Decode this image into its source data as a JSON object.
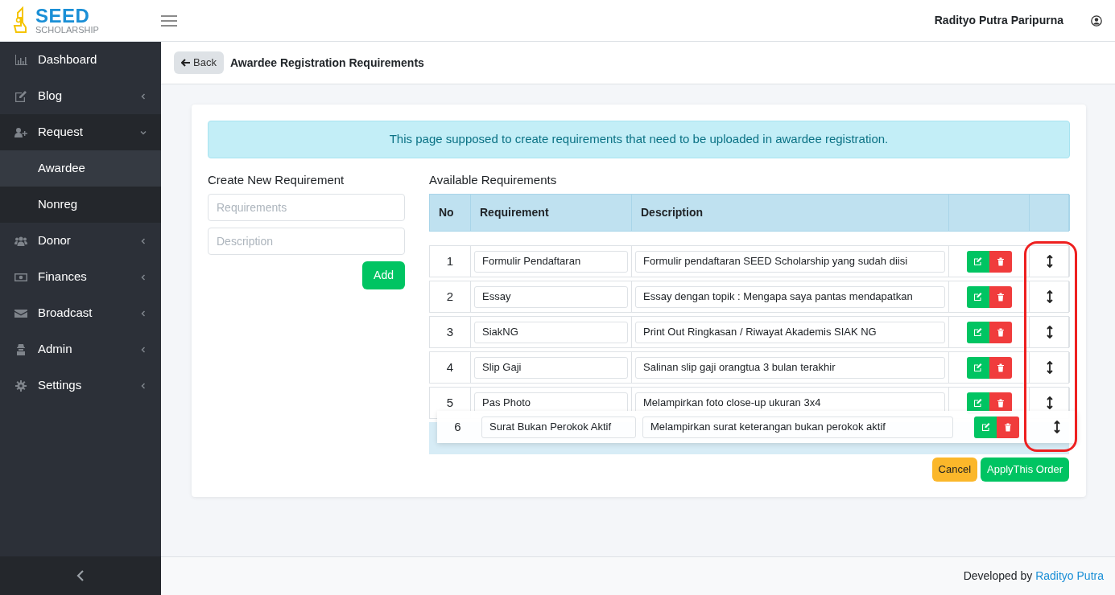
{
  "brand": {
    "name": "SEED",
    "tagline": "SCHOLARSHIP"
  },
  "user": {
    "name": "Radityo Putra Paripurna"
  },
  "sidebar": {
    "items": [
      {
        "label": "Dashboard"
      },
      {
        "label": "Blog",
        "expanded": false
      },
      {
        "label": "Request",
        "expanded": true,
        "children": [
          {
            "label": "Awardee",
            "selected": true
          },
          {
            "label": "Nonreg",
            "selected": false
          }
        ]
      },
      {
        "label": "Donor",
        "expanded": false
      },
      {
        "label": "Finances",
        "expanded": false
      },
      {
        "label": "Broadcast",
        "expanded": false
      },
      {
        "label": "Admin",
        "expanded": false
      },
      {
        "label": "Settings",
        "expanded": false
      }
    ]
  },
  "header": {
    "back": "Back",
    "title": "Awardee Registration Requirements"
  },
  "alert": "This page supposed to create requirements that need to be uploaded in awardee registration.",
  "create_form": {
    "title": "Create New Requirement",
    "requirement_placeholder": "Requirements",
    "description_placeholder": "Description",
    "add": "Add"
  },
  "table": {
    "title": "Available Requirements",
    "columns": [
      "No",
      "Requirement",
      "Description"
    ],
    "rows": [
      {
        "no": "1",
        "requirement": "Formulir Pendaftaran",
        "description": "Formulir pendaftaran SEED Scholarship yang sudah diisi"
      },
      {
        "no": "2",
        "requirement": "Essay",
        "description": "Essay dengan topik : Mengapa saya pantas mendapatkan"
      },
      {
        "no": "3",
        "requirement": "SiakNG",
        "description": "Print Out Ringkasan / Riwayat Akademis SIAK NG"
      },
      {
        "no": "4",
        "requirement": "Slip Gaji",
        "description": "Salinan slip gaji orangtua 3 bulan terakhir"
      },
      {
        "no": "5",
        "requirement": "Pas Photo",
        "description": "Melampirkan foto close-up ukuran 3x4"
      }
    ],
    "dragging_row": {
      "no": "6",
      "requirement": "Surat Bukan Perokok Aktif",
      "description": "Melampirkan surat keterangan bukan perokok aktif"
    }
  },
  "actions": {
    "cancel": "Cancel",
    "apply": "ApplyThis Order"
  },
  "footer": {
    "text": "Developed by",
    "link": "Radityo Putra"
  }
}
